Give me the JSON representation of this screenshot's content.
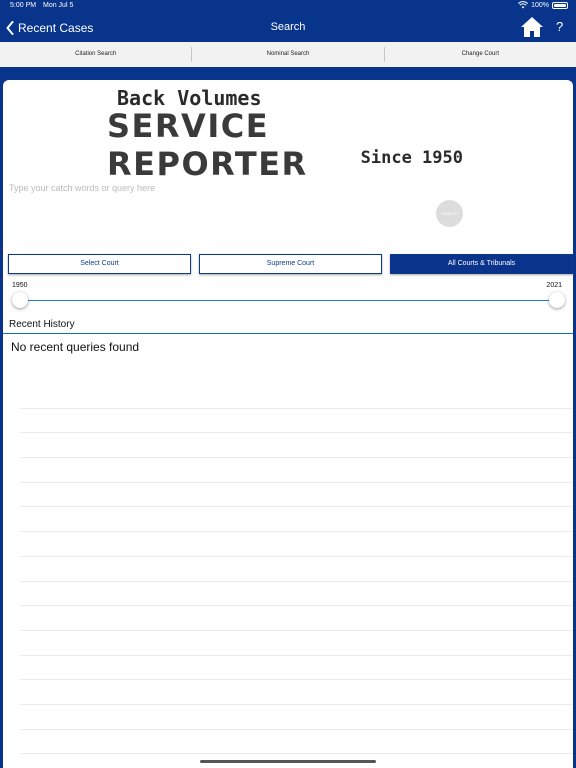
{
  "status_bar": {
    "time": "5:00 PM",
    "date": "Mon Jul 5",
    "battery": "100%",
    "icons": [
      "wifi-icon",
      "battery-icon"
    ]
  },
  "nav": {
    "back_label": "Recent Cases",
    "title": "Search",
    "help_label": "?",
    "icons": [
      "chevron-left-icon",
      "home-icon"
    ]
  },
  "segments": [
    "Citation Search",
    "Nominal Search",
    "Change Court"
  ],
  "logo": {
    "line1": "Back Volumes",
    "line2": "SERVICE REPORTER",
    "line3": "Since 1950"
  },
  "search": {
    "placeholder": "Type your catch words or query here",
    "value": "",
    "button_label": "SEARCH"
  },
  "courts": {
    "options": [
      "Select Court",
      "Supreme Court",
      "All Courts & Tribunals"
    ],
    "selected": "All Courts & Tribunals"
  },
  "year_range": {
    "min_label": "1950",
    "max_label": "2021",
    "min": 1950,
    "max": 2021
  },
  "history": {
    "title": "Recent History",
    "empty_message": "No recent queries found",
    "rows": 15
  },
  "colors": {
    "brand_blue": "#08348c",
    "accent_blue": "#1b7fc4"
  }
}
